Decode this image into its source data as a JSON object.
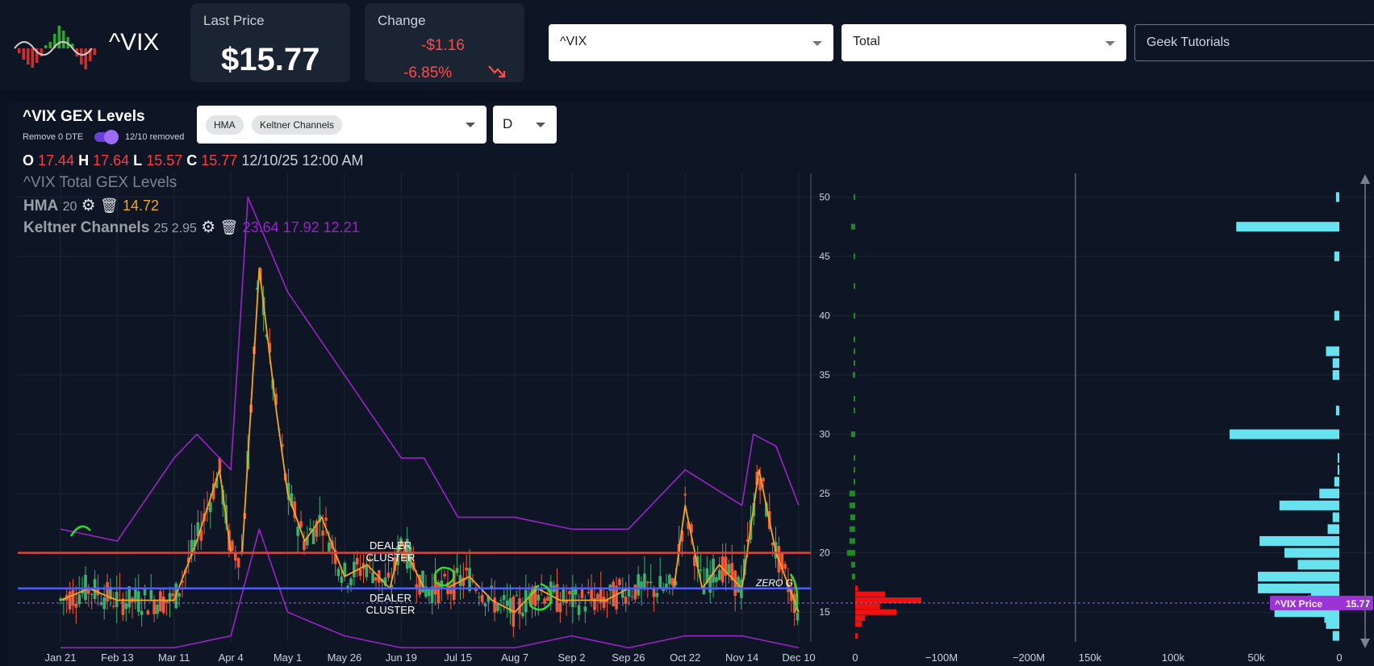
{
  "header": {
    "symbol": "^VIX",
    "last_price_label": "Last Price",
    "last_price": "$15.77",
    "change_label": "Change",
    "change_abs": "-$1.16",
    "change_pct": "-6.85%",
    "symbol_select": "^VIX",
    "type_select": "Total",
    "tutorials_select": "Geek Tutorials"
  },
  "panel": {
    "title": "^VIX GEX Levels",
    "toggle_label": "Remove 0 DTE",
    "toggle_on": true,
    "toggle_value": "12/10 removed",
    "indicators": [
      "HMA",
      "Keltner Channels"
    ],
    "interval": "D"
  },
  "ohlc": {
    "o_label": "O",
    "o": "17.44",
    "h_label": "H",
    "h": "17.64",
    "l_label": "L",
    "l": "15.57",
    "c_label": "C",
    "c": "15.77",
    "datetime": "12/10/25 12:00 AM"
  },
  "legend": {
    "series_title": "^VIX Total GEX Levels",
    "hma_name": "HMA",
    "hma_param": "20",
    "hma_value": "14.72",
    "kc_name": "Keltner Channels",
    "kc_params": "25 2.95",
    "kc_values": "23.64  17.92  12.21"
  },
  "annotations": {
    "dealer_cluster_upper": "DEALER CLUSTER",
    "dealer_cluster_lower": "DEALER CLUSTER",
    "zero_g": "ZERO G",
    "price_tag_label": "^VIX Price",
    "price_tag_value": "15.77"
  },
  "colors": {
    "upper_line": "#d9463e",
    "lower_line": "#4f5ef0",
    "hma": "#f5a623",
    "keltner": "#9b23c8",
    "positive_gex": "#1f8a1f",
    "negative_gex": "#ee1111",
    "bar_cyan": "#66e3ee",
    "price_tag": "#9b33d6"
  },
  "chart_data": [
    {
      "type": "line",
      "title": "^VIX Total GEX Levels",
      "x_ticks": [
        "Jan 21",
        "Feb 13",
        "Mar 11",
        "Apr 4",
        "May 1",
        "May 26",
        "Jun 19",
        "Jul 15",
        "Aug 7",
        "Sep 2",
        "Sep 26",
        "Oct 22",
        "Nov 14",
        "Dec 10"
      ],
      "ylim": [
        12.5,
        52
      ],
      "horizontal_levels": [
        {
          "name": "DEALER CLUSTER",
          "value": 20
        },
        {
          "name": "DEALER CLUSTER",
          "value": 17
        }
      ],
      "series": [
        {
          "name": "HMA",
          "x_index": [
            0,
            0.5,
            1,
            1.5,
            2,
            2.4,
            2.8,
            3,
            3.2,
            3.5,
            3.8,
            4,
            4.3,
            4.6,
            5,
            5.4,
            5.8,
            6,
            6.4,
            6.8,
            7.2,
            7.6,
            8,
            8.4,
            8.8,
            9.2,
            9.6,
            10,
            10.4,
            10.8,
            11,
            11.3,
            11.6,
            12,
            12.3,
            12.6,
            13
          ],
          "values": [
            16,
            17,
            16,
            16,
            16,
            21,
            27,
            20,
            20,
            44,
            32,
            25,
            21,
            23,
            18,
            19,
            17,
            21,
            17,
            17,
            18,
            16,
            15,
            17,
            16,
            16,
            16,
            17,
            17,
            17,
            24,
            17,
            19,
            17,
            27,
            20,
            15
          ]
        },
        {
          "name": "Keltner Channels upper",
          "x_index": [
            0,
            1,
            2,
            2.4,
            3,
            3.3,
            4,
            5,
            6,
            6.4,
            7,
            8,
            9,
            10,
            11,
            12,
            12.2,
            12.6,
            13
          ],
          "values": [
            22,
            21,
            28,
            30,
            27,
            50,
            42,
            35,
            28,
            28,
            23,
            23,
            22,
            22,
            27,
            24,
            30,
            29,
            24
          ]
        },
        {
          "name": "Keltner Channels lower",
          "x_index": [
            0,
            1,
            2,
            3,
            3.5,
            4,
            5,
            6,
            6.5,
            7,
            8,
            9,
            10,
            11,
            12,
            13
          ],
          "values": [
            12,
            12,
            12,
            13,
            22,
            15,
            13,
            12,
            12,
            12,
            12,
            13,
            12,
            13,
            13,
            12
          ]
        }
      ]
    },
    {
      "type": "bar",
      "title": "",
      "orientation": "horizontal",
      "strikes": [
        50,
        47.5,
        45,
        42.5,
        40,
        38,
        37,
        36,
        35,
        33,
        32,
        30,
        28,
        27,
        26,
        25,
        24,
        23,
        22,
        21,
        20,
        19,
        18,
        17,
        16.5,
        16,
        15.5,
        15,
        14.5,
        14,
        13
      ],
      "x_ticks": [
        "0",
        "−100M",
        "−200M"
      ],
      "xlim": [
        0,
        -250
      ],
      "x_unit": "M",
      "values": [
        2,
        5,
        0,
        1,
        2,
        1,
        1,
        1,
        3,
        0,
        1,
        5,
        0,
        0,
        1,
        7,
        7,
        6,
        7,
        7,
        10,
        5,
        4,
        3,
        36,
        80,
        30,
        50,
        12,
        8,
        3
      ]
    },
    {
      "type": "bar",
      "title": "",
      "orientation": "horizontal",
      "strikes": [
        50,
        47.5,
        45,
        42.5,
        40,
        38,
        37,
        36,
        35,
        33,
        32,
        30,
        28,
        27,
        26,
        25,
        24,
        23,
        22,
        21,
        20,
        19,
        18,
        17,
        16.5,
        16,
        15.5,
        15,
        14.5,
        14,
        13
      ],
      "x_ticks": [
        "150k",
        "100k",
        "50k",
        "0"
      ],
      "xlim": [
        150,
        0
      ],
      "x_unit": "k",
      "values": [
        2,
        62,
        3,
        0,
        3,
        0,
        8,
        4,
        4,
        0,
        2,
        66,
        1,
        1,
        3,
        12,
        36,
        4,
        7,
        48,
        33,
        25,
        49,
        49,
        17,
        19,
        8,
        39,
        9,
        8,
        4
      ]
    }
  ]
}
